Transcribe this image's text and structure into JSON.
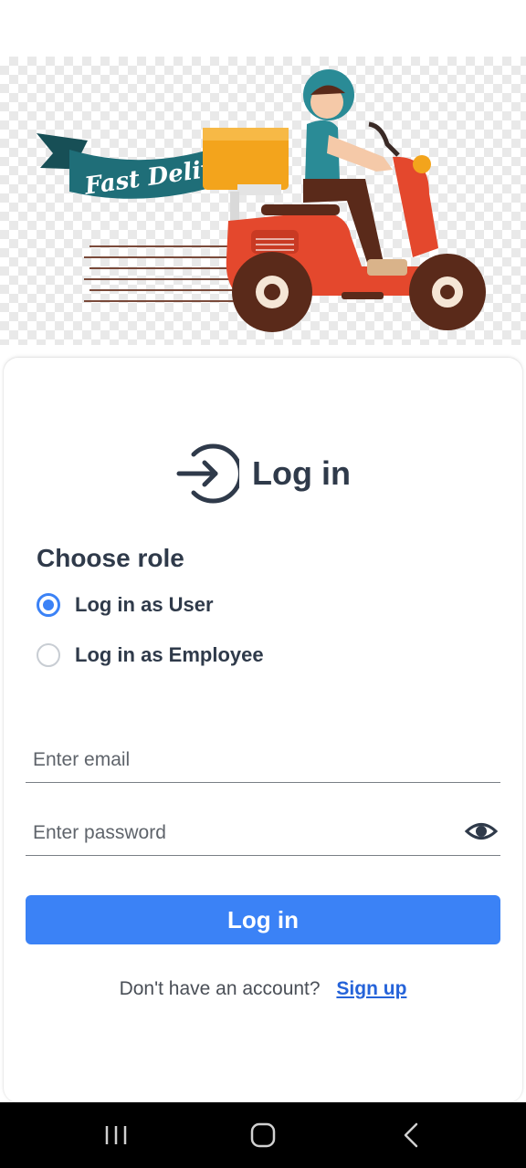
{
  "hero": {
    "banner_text": "Fast Delivery",
    "colors": {
      "banner": "#1f6e78",
      "scooter": "#e4482d",
      "box": "#f3a41c",
      "helmet": "#2a8b96",
      "wheel": "#5a2a1a"
    }
  },
  "login": {
    "title": "Log in",
    "title_icon": "login-arrow-icon",
    "choose_role_label": "Choose role",
    "roles": [
      {
        "label": "Log in as User",
        "selected": true
      },
      {
        "label": "Log in as Employee",
        "selected": false
      }
    ],
    "email": {
      "placeholder": "Enter email",
      "value": ""
    },
    "password": {
      "placeholder": "Enter password",
      "value": "",
      "toggle_icon": "eye-icon"
    },
    "submit_label": "Log in",
    "no_account_text": "Don't have an account?",
    "signup_label": "Sign up"
  },
  "nav_bar": {
    "icons": [
      "recents-icon",
      "home-icon",
      "back-icon"
    ]
  },
  "colors": {
    "accent": "#3b82f6",
    "link": "#2563d9",
    "text": "#2f3a4a"
  }
}
